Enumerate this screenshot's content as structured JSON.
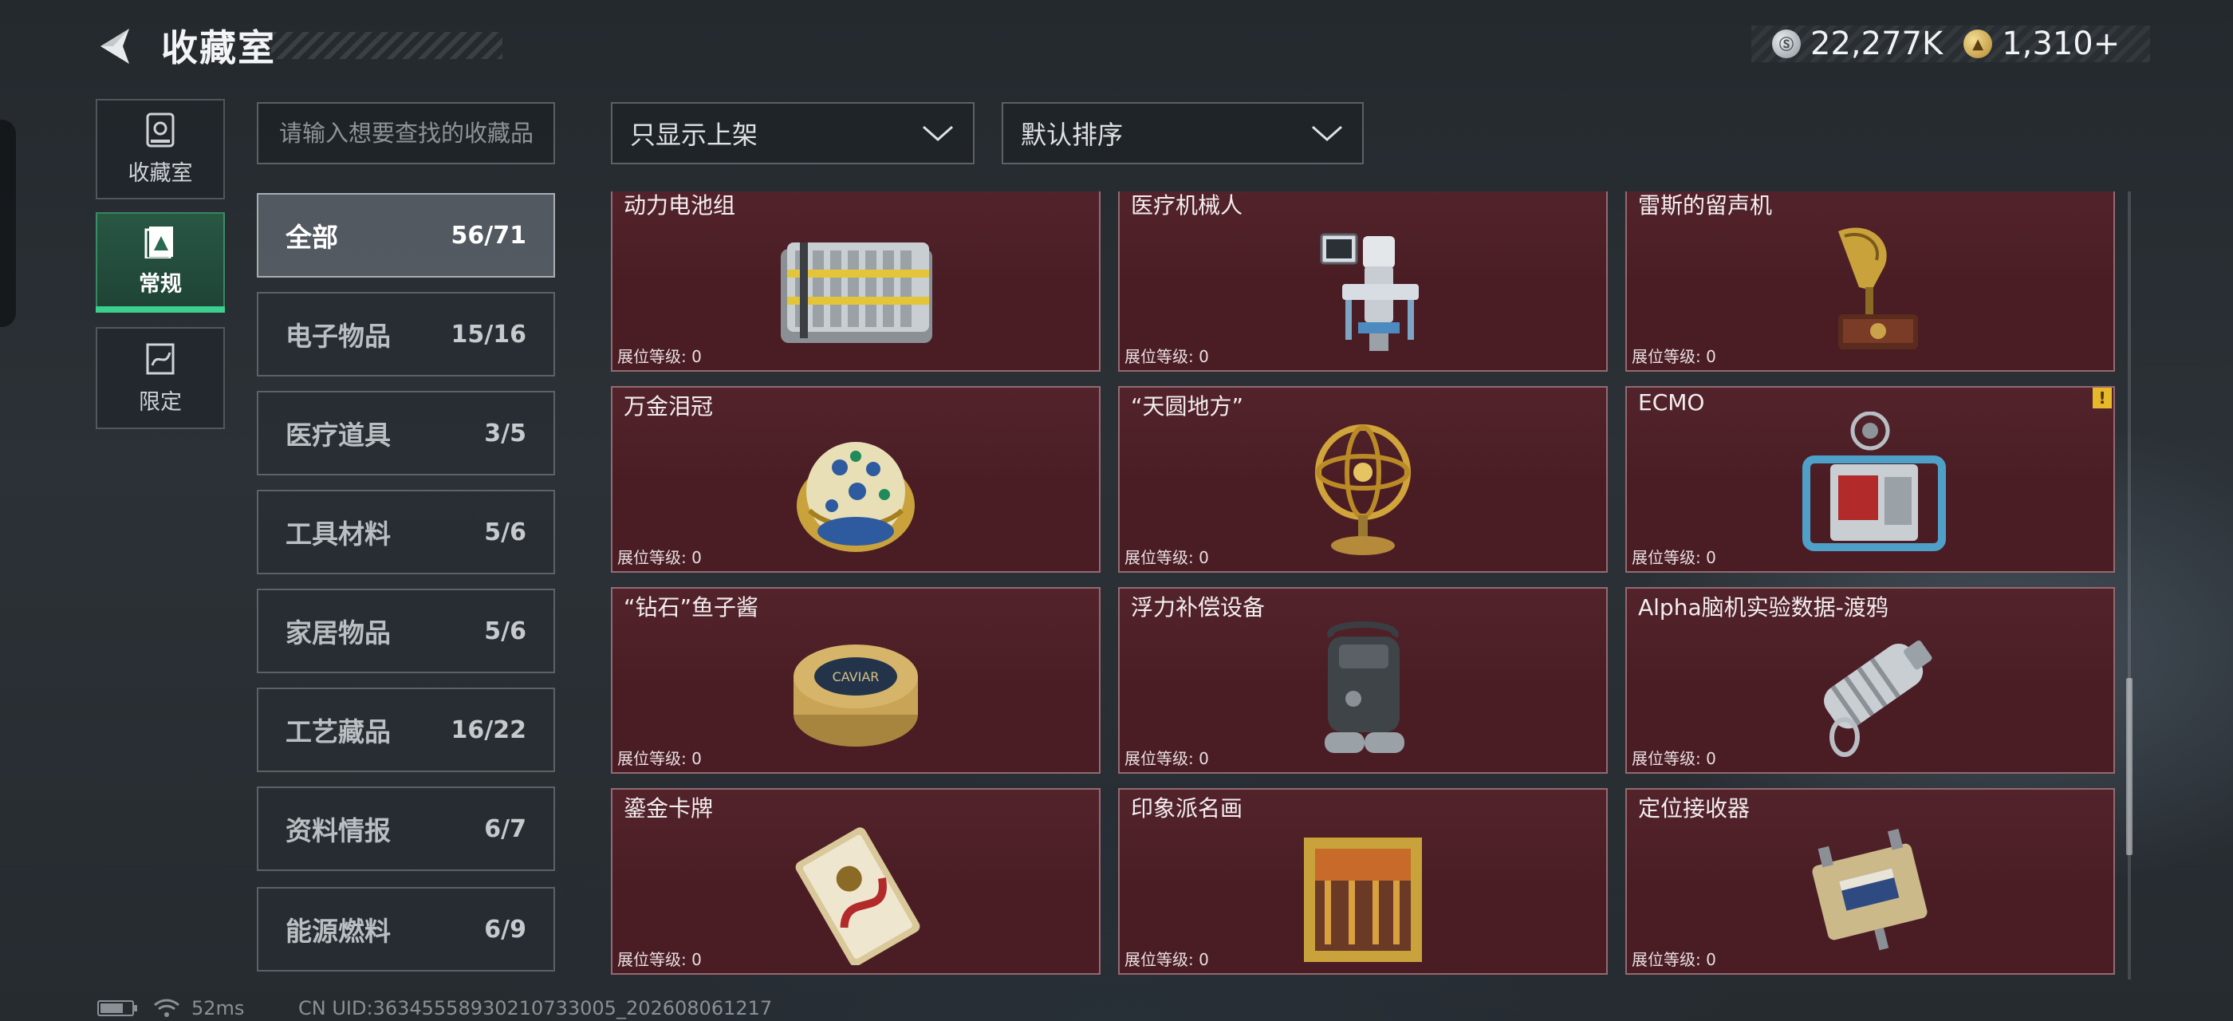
{
  "header": {
    "title": "收藏室",
    "currency": [
      {
        "icon": "silver-coin-icon",
        "value": "22,277K"
      },
      {
        "icon": "gold-coin-icon",
        "value": "1,310+"
      }
    ]
  },
  "side_tabs": [
    {
      "label": "收藏室",
      "icon": "vault-icon",
      "active": false
    },
    {
      "label": "常规",
      "icon": "collection-card-icon",
      "active": true
    },
    {
      "label": "限定",
      "icon": "limited-card-icon",
      "active": false
    }
  ],
  "search": {
    "placeholder": "请输入想要查找的收藏品"
  },
  "filters": {
    "display": "只显示上架",
    "sort": "默认排序"
  },
  "categories": [
    {
      "name": "全部",
      "count": "56/71",
      "active": true
    },
    {
      "name": "电子物品",
      "count": "15/16"
    },
    {
      "name": "医疗道具",
      "count": "3/5"
    },
    {
      "name": "工具材料",
      "count": "5/6"
    },
    {
      "name": "家居物品",
      "count": "5/6"
    },
    {
      "name": "工艺藏品",
      "count": "16/22"
    },
    {
      "name": "资料情报",
      "count": "6/7"
    },
    {
      "name": "能源燃料",
      "count": "6/9"
    }
  ],
  "level_label": "展位等级: 0",
  "items": [
    {
      "name": "动力电池组",
      "icon": "battery-pack-icon"
    },
    {
      "name": "医疗机械人",
      "icon": "medical-robot-icon"
    },
    {
      "name": "雷斯的留声机",
      "icon": "gramophone-icon"
    },
    {
      "name": "万金泪冠",
      "icon": "jeweled-egg-icon"
    },
    {
      "name": "“天圆地方”",
      "icon": "armillary-sphere-icon"
    },
    {
      "name": "ECMO",
      "icon": "ecmo-machine-icon",
      "warning": "!"
    },
    {
      "name": "“钻石”鱼子酱",
      "icon": "caviar-tin-icon",
      "tin_text": "CAVIAR"
    },
    {
      "name": "浮力补偿设备",
      "icon": "buoyancy-device-icon"
    },
    {
      "name": "Alpha脑机实验数据-渡鸦",
      "icon": "data-capsule-icon"
    },
    {
      "name": "鎏金卡牌",
      "icon": "gilded-card-icon"
    },
    {
      "name": "印象派名画",
      "icon": "framed-painting-icon"
    },
    {
      "name": "定位接收器",
      "icon": "locator-receiver-icon"
    }
  ],
  "footer": {
    "ping": "52ms",
    "uid": "CN UID:3634555893021073300​5_202608061217"
  }
}
